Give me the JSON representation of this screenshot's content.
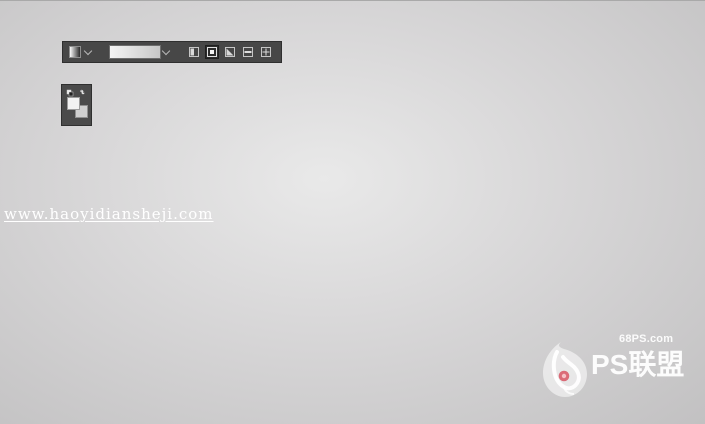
{
  "watermark": {
    "url": "www.haoyidiansheji.com"
  },
  "logo": {
    "site": "68PS.com",
    "brand": "PS联盟"
  },
  "toolbar": {
    "gradient_preset_icon": "gradient-preset-icon",
    "gradient_picker_colors": [
      "#f4f4f4",
      "#c7c7c7"
    ],
    "gradient_types": [
      "linear",
      "radial",
      "angle",
      "reflected",
      "diamond"
    ],
    "selected_type": "radial"
  },
  "colors": {
    "foreground": "#f2f2f2",
    "background": "#cfcfcf",
    "toolbar": "#474747"
  }
}
